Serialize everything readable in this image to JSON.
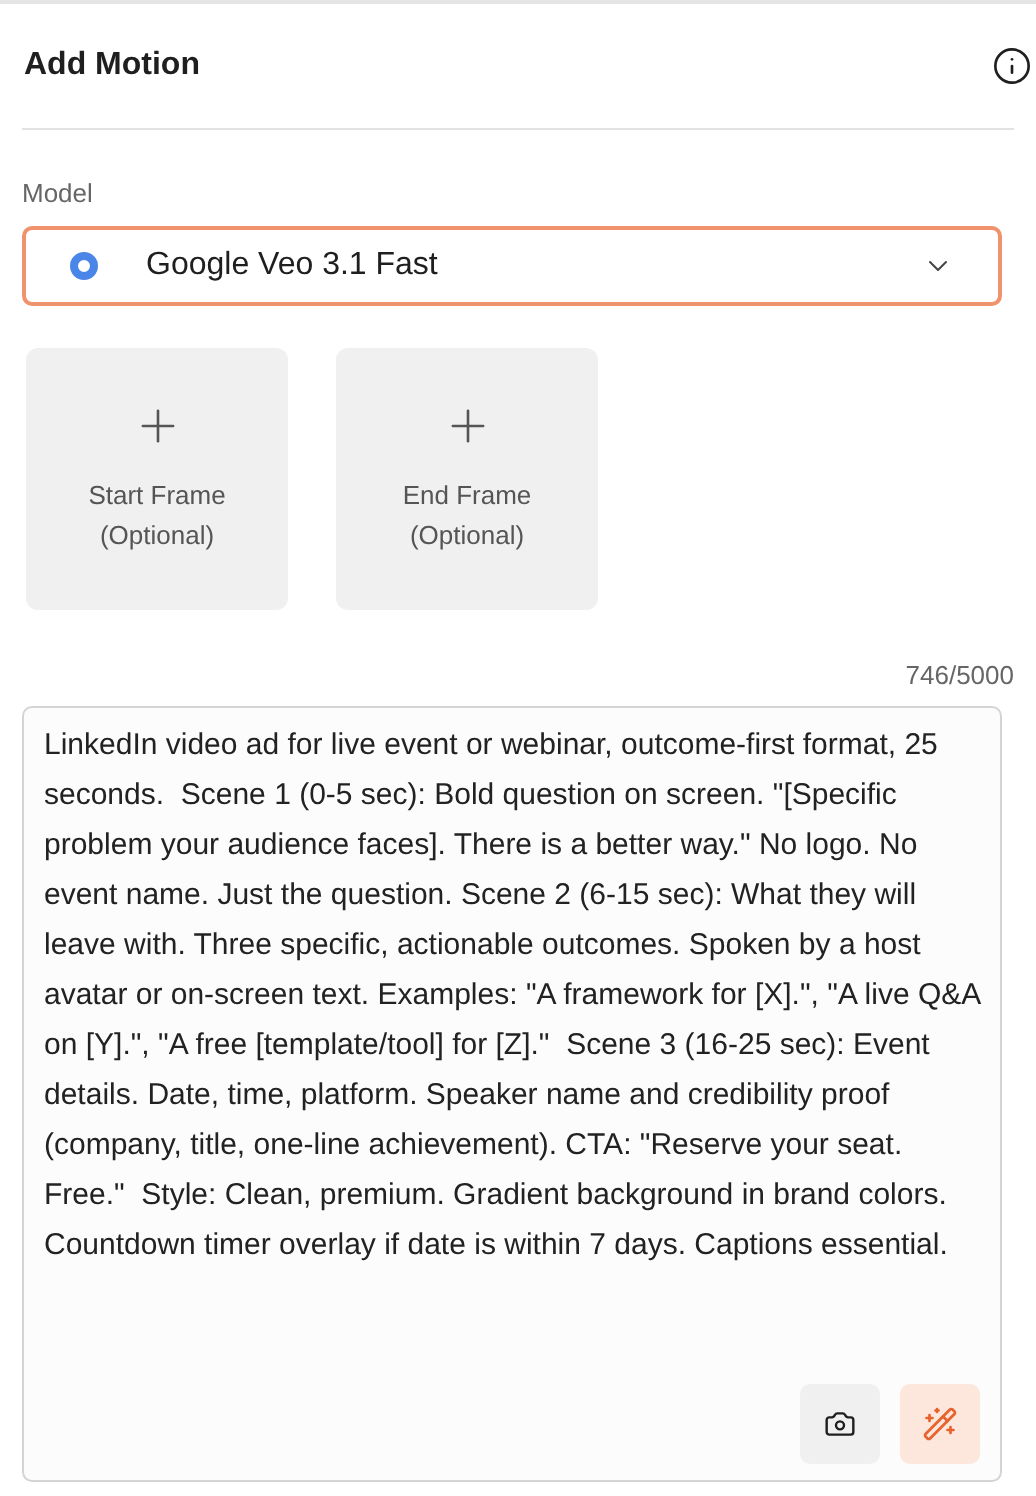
{
  "header": {
    "title": "Add Motion"
  },
  "model": {
    "label": "Model",
    "value": "Google Veo 3.1 Fast",
    "focused": true
  },
  "frames": [
    {
      "label": "Start Frame\n(Optional)"
    },
    {
      "label": "End Frame\n(Optional)"
    }
  ],
  "prompt": {
    "counter": "746/5000",
    "value": "LinkedIn video ad for live event or webinar, outcome-first format, 25 seconds.  Scene 1 (0-5 sec): Bold question on screen. \"[Specific problem your audience faces]. There is a better way.\" No logo. No event name. Just the question. Scene 2 (6-15 sec): What they will leave with. Three specific, actionable outcomes. Spoken by a host avatar or on-screen text. Examples: \"A framework for [X].\", \"A live Q&A on [Y].\", \"A free [template/tool] for [Z].\"  Scene 3 (16-25 sec): Event details. Date, time, platform. Speaker name and credibility proof (company, title, one-line achievement). CTA: \"Reserve your seat. Free.\"  Style: Clean, premium. Gradient background in brand colors. Countdown timer overlay if date is within 7 days. Captions essential."
  }
}
